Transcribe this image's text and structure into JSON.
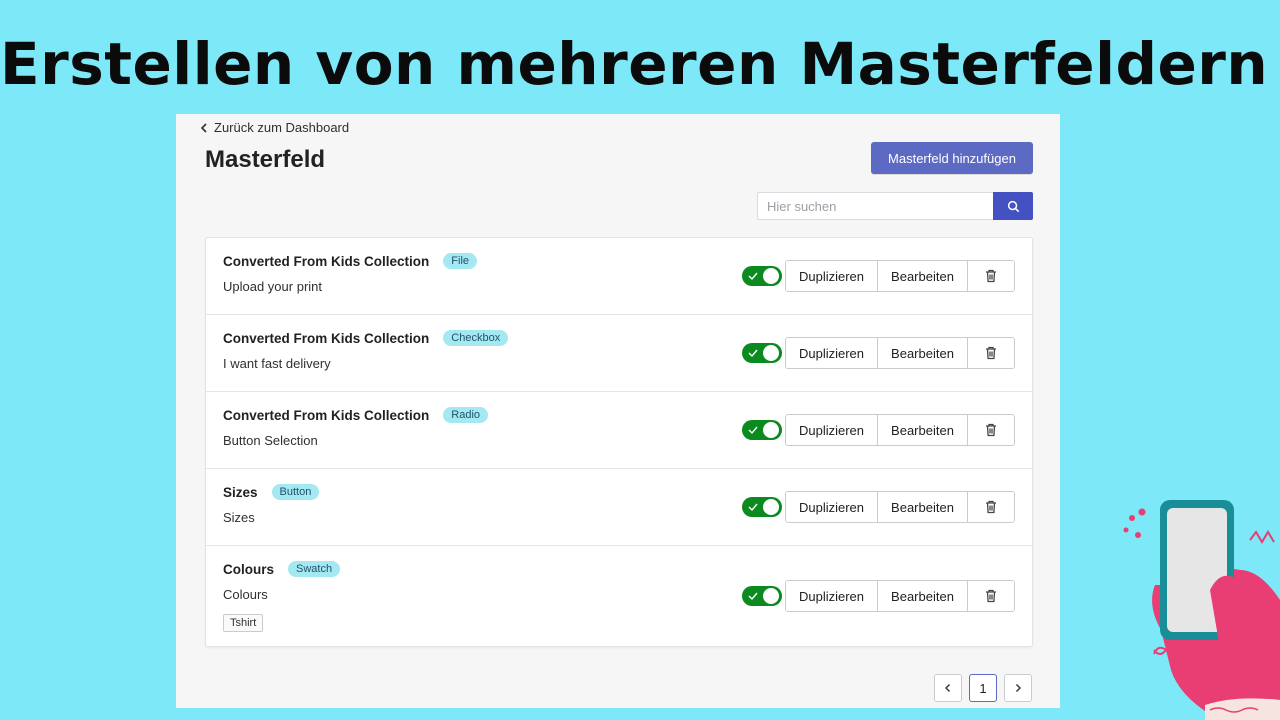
{
  "headline": "Erstellen von mehreren Masterfeldern",
  "nav": {
    "back_label": "Zurück zum Dashboard"
  },
  "page": {
    "title": "Masterfeld",
    "primary_action": "Masterfeld hinzufügen"
  },
  "search": {
    "placeholder": "Hier suchen",
    "value": ""
  },
  "actions": {
    "duplicate": "Duplizieren",
    "edit": "Bearbeiten"
  },
  "rows": [
    {
      "title": "Converted From Kids Collection",
      "badge": "File",
      "subtitle": "Upload your print",
      "enabled": true
    },
    {
      "title": "Converted From Kids Collection",
      "badge": "Checkbox",
      "subtitle": "I want fast delivery",
      "enabled": true
    },
    {
      "title": "Converted From Kids Collection",
      "badge": "Radio",
      "subtitle": "Button Selection",
      "enabled": true
    },
    {
      "title": "Sizes",
      "badge": "Button",
      "subtitle": "Sizes",
      "enabled": true
    },
    {
      "title": "Colours",
      "badge": "Swatch",
      "subtitle": "Colours",
      "tag": "Tshirt",
      "enabled": true
    }
  ],
  "pagination": {
    "current_page": "1"
  },
  "colors": {
    "background": "#7ce8f8",
    "primary": "#5c6ac4",
    "search_button": "#4351c3",
    "toggle_on": "#0a8a1f",
    "badge": "#a4e8f2"
  },
  "icons": [
    "chevron-left-icon",
    "search-icon",
    "check-icon",
    "trash-icon",
    "chevron-right-icon"
  ]
}
